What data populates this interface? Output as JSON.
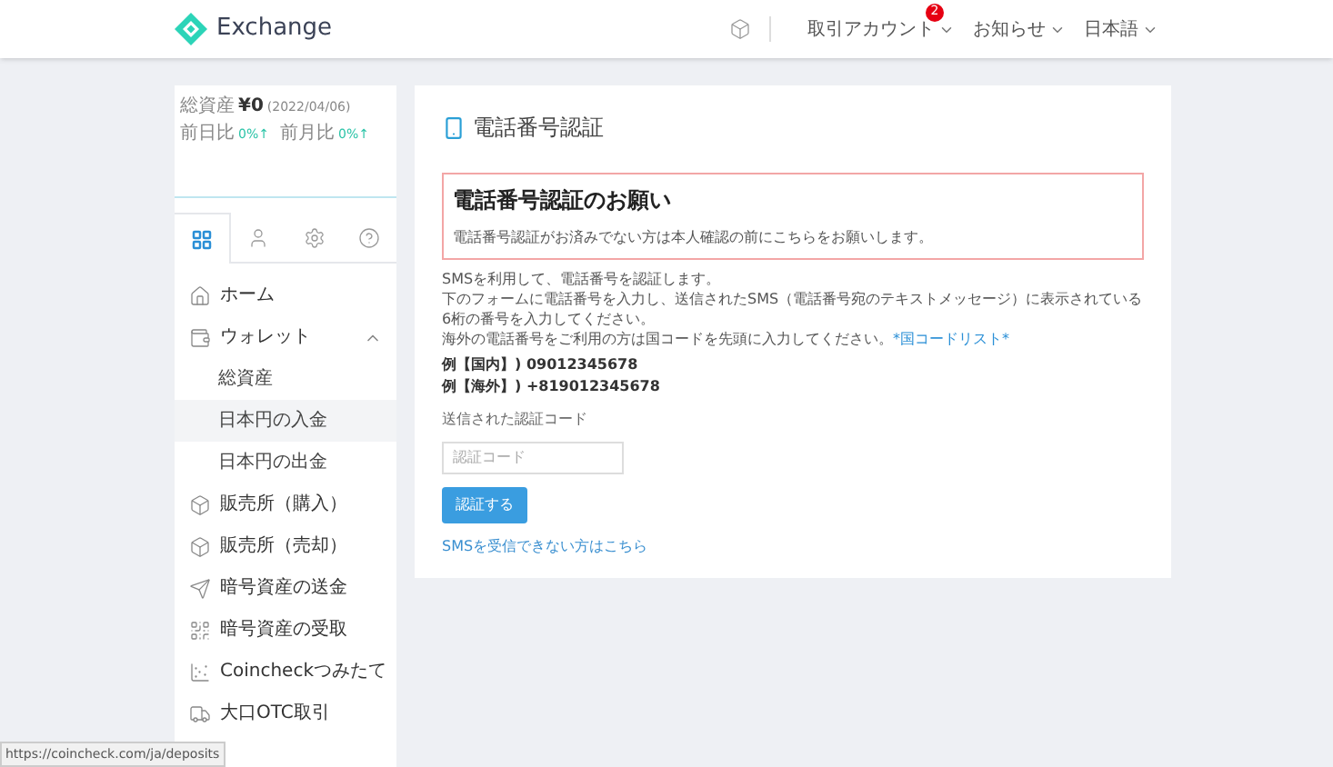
{
  "header": {
    "brand": "Exchange",
    "menus": [
      {
        "label": "取引アカウント",
        "badge": "2"
      },
      {
        "label": "お知らせ"
      },
      {
        "label": "日本語"
      }
    ]
  },
  "sidebar": {
    "summary": {
      "total_label": "総資産",
      "total_value": "¥0",
      "date": "(2022/04/06)",
      "changes": [
        {
          "label": "前日比",
          "value": "0%↑"
        },
        {
          "label": "前月比",
          "value": "0%↑"
        }
      ]
    },
    "tabs": [
      {
        "selected": true
      },
      {
        "selected": false
      },
      {
        "selected": false
      },
      {
        "selected": false
      }
    ],
    "items": [
      {
        "label": "ホーム",
        "selected": false
      },
      {
        "label": "ウォレット",
        "expanded": true,
        "selected": false,
        "children": [
          {
            "label": "総資産",
            "selected": false
          },
          {
            "label": "日本円の入金",
            "selected": true
          },
          {
            "label": "日本円の出金",
            "selected": false
          }
        ]
      },
      {
        "label": "販売所（購入）",
        "selected": false
      },
      {
        "label": "販売所（売却）",
        "selected": false
      },
      {
        "label": "暗号資産の送金",
        "selected": false
      },
      {
        "label": "暗号資産の受取",
        "selected": false
      },
      {
        "label": "Coincheckつみたて",
        "selected": false
      },
      {
        "label": "大口OTC取引",
        "selected": false
      }
    ]
  },
  "main": {
    "title": "電話番号認証",
    "notice": {
      "heading": "電話番号認証のお願い",
      "text": "電話番号認証がお済みでない方は本人確認の前にこちらをお願いします。"
    },
    "paragraphs": [
      "SMSを利用して、電話番号を認証します。",
      "下のフォームに電話番号を入力し、送信されたSMS（電話番号宛のテキストメッセージ）に表示されている6桁の番号を入力してください。"
    ],
    "country_note": {
      "text": "海外の電話番号をご利用の方は国コードを先頭に入力してください。",
      "link": "*国コードリスト*"
    },
    "examples": [
      "例【国内】) 09012345678",
      "例【海外】) +819012345678"
    ],
    "code_field": {
      "label": "送信された認証コード",
      "placeholder": "認証コード"
    },
    "submit": "認証する",
    "help_link": "SMSを受信できない方はこちら"
  },
  "status_bar": "https://coincheck.com/ja/deposits"
}
